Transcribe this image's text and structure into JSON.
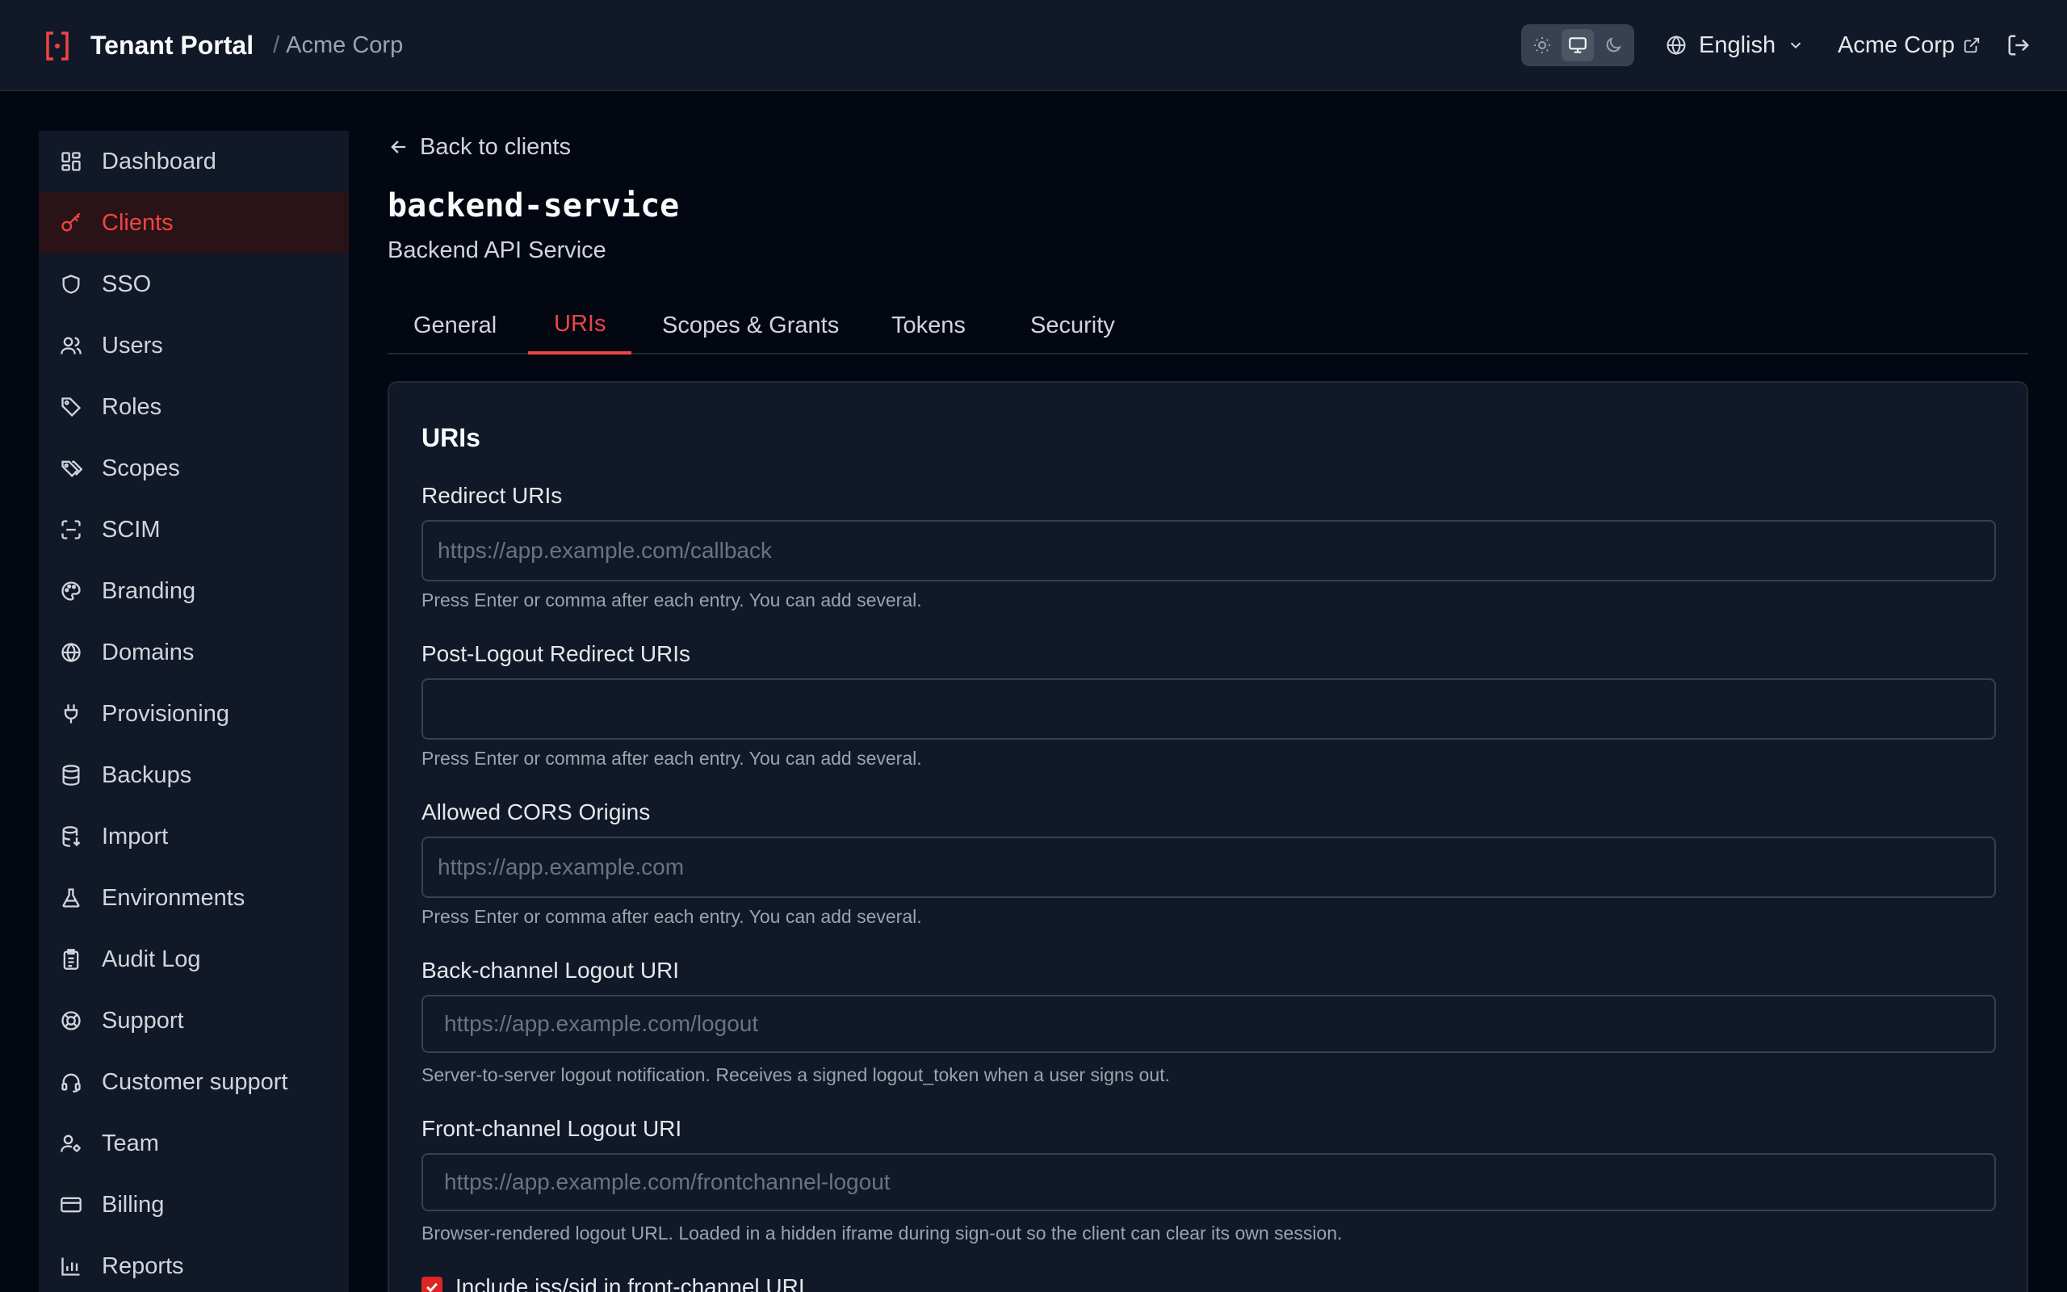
{
  "header": {
    "app_title": "Tenant Portal",
    "separator": "/",
    "org_name": "Acme Corp",
    "language": "English",
    "tenant_link": "Acme Corp",
    "theme_modes": [
      "light",
      "system",
      "dark"
    ],
    "active_theme": "system"
  },
  "sidebar": {
    "items": [
      {
        "label": "Dashboard",
        "icon": "dashboard-icon"
      },
      {
        "label": "Clients",
        "icon": "key-icon",
        "active": true
      },
      {
        "label": "SSO",
        "icon": "shield-icon"
      },
      {
        "label": "Users",
        "icon": "users-icon"
      },
      {
        "label": "Roles",
        "icon": "tag-icon"
      },
      {
        "label": "Scopes",
        "icon": "tags-icon"
      },
      {
        "label": "SCIM",
        "icon": "scan-icon"
      },
      {
        "label": "Branding",
        "icon": "palette-icon"
      },
      {
        "label": "Domains",
        "icon": "globe-icon"
      },
      {
        "label": "Provisioning",
        "icon": "plug-icon"
      },
      {
        "label": "Backups",
        "icon": "database-icon"
      },
      {
        "label": "Import",
        "icon": "database-import-icon"
      },
      {
        "label": "Environments",
        "icon": "flask-icon"
      },
      {
        "label": "Audit Log",
        "icon": "clipboard-icon"
      },
      {
        "label": "Support",
        "icon": "life-buoy-icon"
      },
      {
        "label": "Customer support",
        "icon": "headset-icon"
      },
      {
        "label": "Team",
        "icon": "user-cog-icon"
      },
      {
        "label": "Billing",
        "icon": "credit-card-icon"
      },
      {
        "label": "Reports",
        "icon": "bar-chart-icon"
      }
    ]
  },
  "main": {
    "back_label": "Back to clients",
    "title": "backend-service",
    "subtitle": "Backend API Service",
    "tabs": [
      {
        "label": "General"
      },
      {
        "label": "URIs",
        "active": true
      },
      {
        "label": "Scopes & Grants"
      },
      {
        "label": "Tokens"
      },
      {
        "label": "Security"
      }
    ],
    "card": {
      "title": "URIs",
      "redirect": {
        "label": "Redirect URIs",
        "value": "",
        "placeholder": "https://app.example.com/callback",
        "help": "Press Enter or comma after each entry. You can add several."
      },
      "post_logout": {
        "label": "Post-Logout Redirect URIs",
        "value": "",
        "placeholder": "",
        "help": "Press Enter or comma after each entry. You can add several."
      },
      "cors": {
        "label": "Allowed CORS Origins",
        "value": "",
        "placeholder": "https://app.example.com",
        "help": "Press Enter or comma after each entry. You can add several."
      },
      "backchannel": {
        "label": "Back-channel Logout URI",
        "value": "",
        "placeholder": "https://app.example.com/logout",
        "help": "Server-to-server logout notification. Receives a signed logout_token when a user signs out."
      },
      "frontchannel": {
        "label": "Front-channel Logout URI",
        "value": "",
        "placeholder": "https://app.example.com/frontchannel-logout",
        "help": "Browser-rendered logout URL. Loaded in a hidden iframe during sign-out so the client can clear its own session."
      },
      "include_iss_sid": {
        "label": "Include iss/sid in front-channel URI",
        "checked": true
      }
    }
  },
  "colors": {
    "accent": "#ef4444",
    "background": "#030712",
    "surface": "#111827"
  }
}
